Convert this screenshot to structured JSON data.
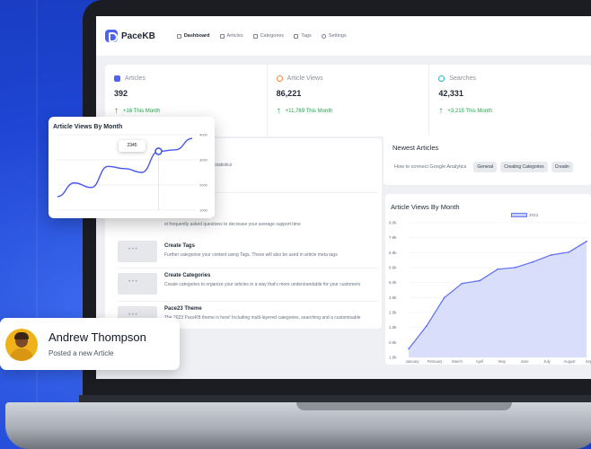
{
  "app": {
    "logo_text": "PaceKB"
  },
  "nav": {
    "items": [
      {
        "label": "Dashboard",
        "icon": "dashboard-icon"
      },
      {
        "label": "Articles",
        "icon": "articles-icon"
      },
      {
        "label": "Categories",
        "icon": "folder-icon"
      },
      {
        "label": "Tags",
        "icon": "tag-icon"
      },
      {
        "label": "Settings",
        "icon": "gear-icon"
      }
    ]
  },
  "stats": [
    {
      "label": "Articles",
      "value": "392",
      "change": "+16 This Month",
      "icon": "document-icon",
      "color": "#4d63f3"
    },
    {
      "label": "Article Views",
      "value": "86,221",
      "change": "+11,769 This Month",
      "icon": "eye-icon",
      "color": "#f08a3c"
    },
    {
      "label": "Searches",
      "value": "42,331",
      "change": "+3,215 This Month",
      "icon": "search-icon",
      "color": "#22b8cf"
    }
  ],
  "tasks": [
    {
      "title": "",
      "desc": "website including activity statistics"
    },
    {
      "title": "",
      "desc": "st frequently asked questions to decrease your average support time"
    },
    {
      "title": "Create Tags",
      "desc": "Further categorise your content using Tags. These will also be used in article meta tags"
    },
    {
      "title": "Create Categories",
      "desc": "Create categories to organize your articles in a way that's more understandable for your customers"
    },
    {
      "title": "Pace23 Theme",
      "desc": "The 2023 PaceKB theme is here! Including multi-layered categories, searching and a customisable design!"
    }
  ],
  "newest": {
    "title": "Newest Articles",
    "article": "How to connect Google Analytics",
    "chips": [
      "General",
      "Creating Categories",
      "Creatin"
    ]
  },
  "main_chart": {
    "title": "Article Views By Month",
    "legend": "2023"
  },
  "popup_chart": {
    "title": "Article Views By Month",
    "tooltip": "2345"
  },
  "profile": {
    "name": "Andrew Thompson",
    "action": "Posted a new Article"
  },
  "chart_data": [
    {
      "type": "area",
      "title": "Article Views By Month",
      "series": [
        {
          "name": "2023",
          "values": [
            1.15,
            1.55,
            2.05,
            2.3,
            2.35,
            2.55,
            2.58,
            2.68,
            2.8,
            2.85,
            3.04
          ]
        }
      ],
      "categories": [
        "January",
        "February",
        "March",
        "April",
        "May",
        "June",
        "July",
        "August",
        "Septem"
      ],
      "y_ticks": [
        "8.0k",
        "7.8k",
        "6.8k",
        "6.6k",
        "6.0k",
        "3.8k",
        "2.8k",
        "1.8k",
        "0.8k",
        "1.8k"
      ],
      "ylim": [
        1.0,
        3.4
      ],
      "grid": true
    },
    {
      "type": "line",
      "title": "Article Views By Month",
      "values": [
        0.18,
        0.36,
        0.3,
        0.58,
        0.55,
        0.5,
        0.78,
        0.8,
        0.95
      ],
      "y_ticks": [
        "4000",
        "3000",
        "2000",
        "1000"
      ],
      "ylim": [
        0,
        1
      ],
      "highlight": {
        "index": 6,
        "label": "2345"
      }
    }
  ]
}
